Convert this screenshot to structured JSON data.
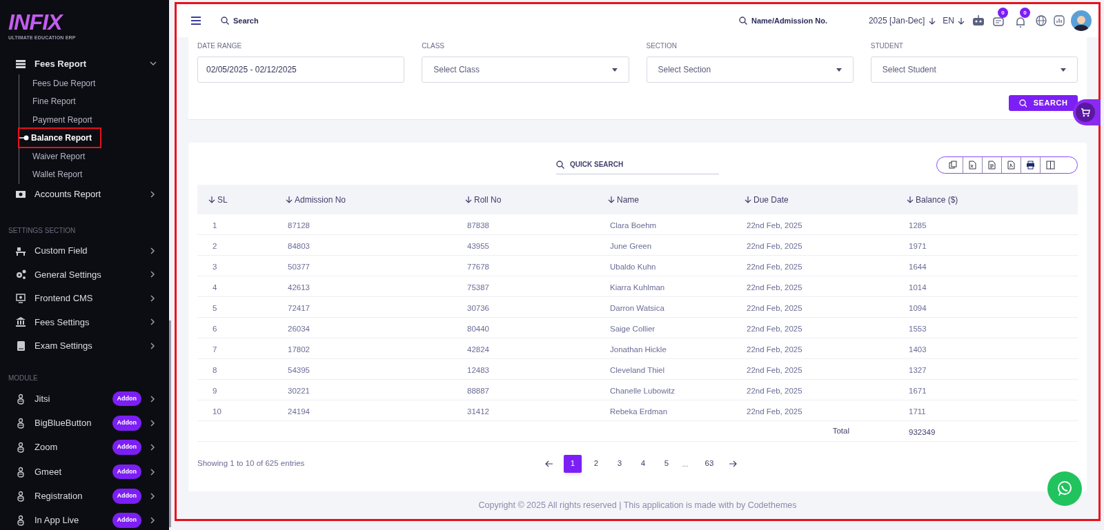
{
  "sidebar": {
    "logo": {
      "text": "INFIX",
      "tagline": "ULTIMATE EDUCATION ERP"
    },
    "items": [
      {
        "label": "Fees Report",
        "expanded": true,
        "children": [
          {
            "label": "Fees Due Report",
            "selected": false
          },
          {
            "label": "Fine Report",
            "selected": false
          },
          {
            "label": "Payment Report",
            "selected": false
          },
          {
            "label": "Balance Report",
            "selected": true
          },
          {
            "label": "Waiver Report",
            "selected": false
          },
          {
            "label": "Wallet Report",
            "selected": false
          }
        ]
      },
      {
        "label": "Accounts Report",
        "expanded": false
      }
    ],
    "sections": [
      {
        "title": "SETTINGS SECTION",
        "items": [
          {
            "label": "Custom Field"
          },
          {
            "label": "General Settings"
          },
          {
            "label": "Frontend CMS"
          },
          {
            "label": "Fees Settings"
          },
          {
            "label": "Exam Settings"
          }
        ]
      },
      {
        "title": "MODULE",
        "items": [
          {
            "label": "Jitsi",
            "badge": "Addon"
          },
          {
            "label": "BigBlueButton",
            "badge": "Addon"
          },
          {
            "label": "Zoom",
            "badge": "Addon"
          },
          {
            "label": "Gmeet",
            "badge": "Addon"
          },
          {
            "label": "Registration",
            "badge": "Addon"
          },
          {
            "label": "In App Live",
            "badge": "Addon"
          }
        ]
      }
    ]
  },
  "top_bar": {
    "search": {
      "placeholder": "Search"
    },
    "name_search": {
      "placeholder": "Name/Admission No."
    },
    "year": "2025 [Jan-Dec]",
    "language": "EN",
    "chat_count": "0",
    "notification_count": "0"
  },
  "filters": {
    "fields": [
      {
        "label": "DATE RANGE",
        "kind": "input",
        "value": "02/05/2025 - 02/12/2025"
      },
      {
        "label": "CLASS",
        "kind": "select",
        "placeholder": "Select Class"
      },
      {
        "label": "SECTION",
        "kind": "select",
        "placeholder": "Select Section"
      },
      {
        "label": "STUDENT",
        "kind": "select",
        "placeholder": "Select Student"
      }
    ],
    "search_button": "SEARCH"
  },
  "table": {
    "quick_search": {
      "placeholder": "QUICK SEARCH"
    },
    "columns": [
      "SL",
      "Admission No",
      "Roll No",
      "Name",
      "Due Date",
      "Balance ($)"
    ],
    "rows": [
      [
        "1",
        "87128",
        "87838",
        "Clara Boehm",
        "22nd Feb, 2025",
        "1285"
      ],
      [
        "2",
        "84803",
        "43955",
        "June Green",
        "22nd Feb, 2025",
        "1971"
      ],
      [
        "3",
        "50377",
        "77678",
        "Ubaldo Kuhn",
        "22nd Feb, 2025",
        "1644"
      ],
      [
        "4",
        "42613",
        "75387",
        "Kiarra Kuhlman",
        "22nd Feb, 2025",
        "1014"
      ],
      [
        "5",
        "72417",
        "30736",
        "Darron Watsica",
        "22nd Feb, 2025",
        "1094"
      ],
      [
        "6",
        "26034",
        "80440",
        "Saige Collier",
        "22nd Feb, 2025",
        "1553"
      ],
      [
        "7",
        "17802",
        "42824",
        "Jonathan Hickle",
        "22nd Feb, 2025",
        "1403"
      ],
      [
        "8",
        "54395",
        "12483",
        "Cleveland Thiel",
        "22nd Feb, 2025",
        "1327"
      ],
      [
        "9",
        "30221",
        "88887",
        "Chanelle Lubowitz",
        "22nd Feb, 2025",
        "1671"
      ],
      [
        "10",
        "24194",
        "31412",
        "Rebeka Erdman",
        "22nd Feb, 2025",
        "1711"
      ]
    ],
    "total": {
      "label": "Total",
      "value": "932349"
    },
    "info": "Showing 1 to 10 of 625 entries",
    "pages": [
      {
        "kind": "page",
        "label": "1",
        "selected": true
      },
      {
        "kind": "page",
        "label": "2",
        "selected": false
      },
      {
        "kind": "page",
        "label": "3",
        "selected": false
      },
      {
        "kind": "page",
        "label": "4",
        "selected": false
      },
      {
        "kind": "page",
        "label": "5",
        "selected": false
      },
      {
        "kind": "ellipsis",
        "label": "..."
      },
      {
        "kind": "page",
        "label": "63",
        "selected": false
      }
    ]
  },
  "footer": "Copyright © 2025 All rights reserved | This application is made with by Codethemes"
}
